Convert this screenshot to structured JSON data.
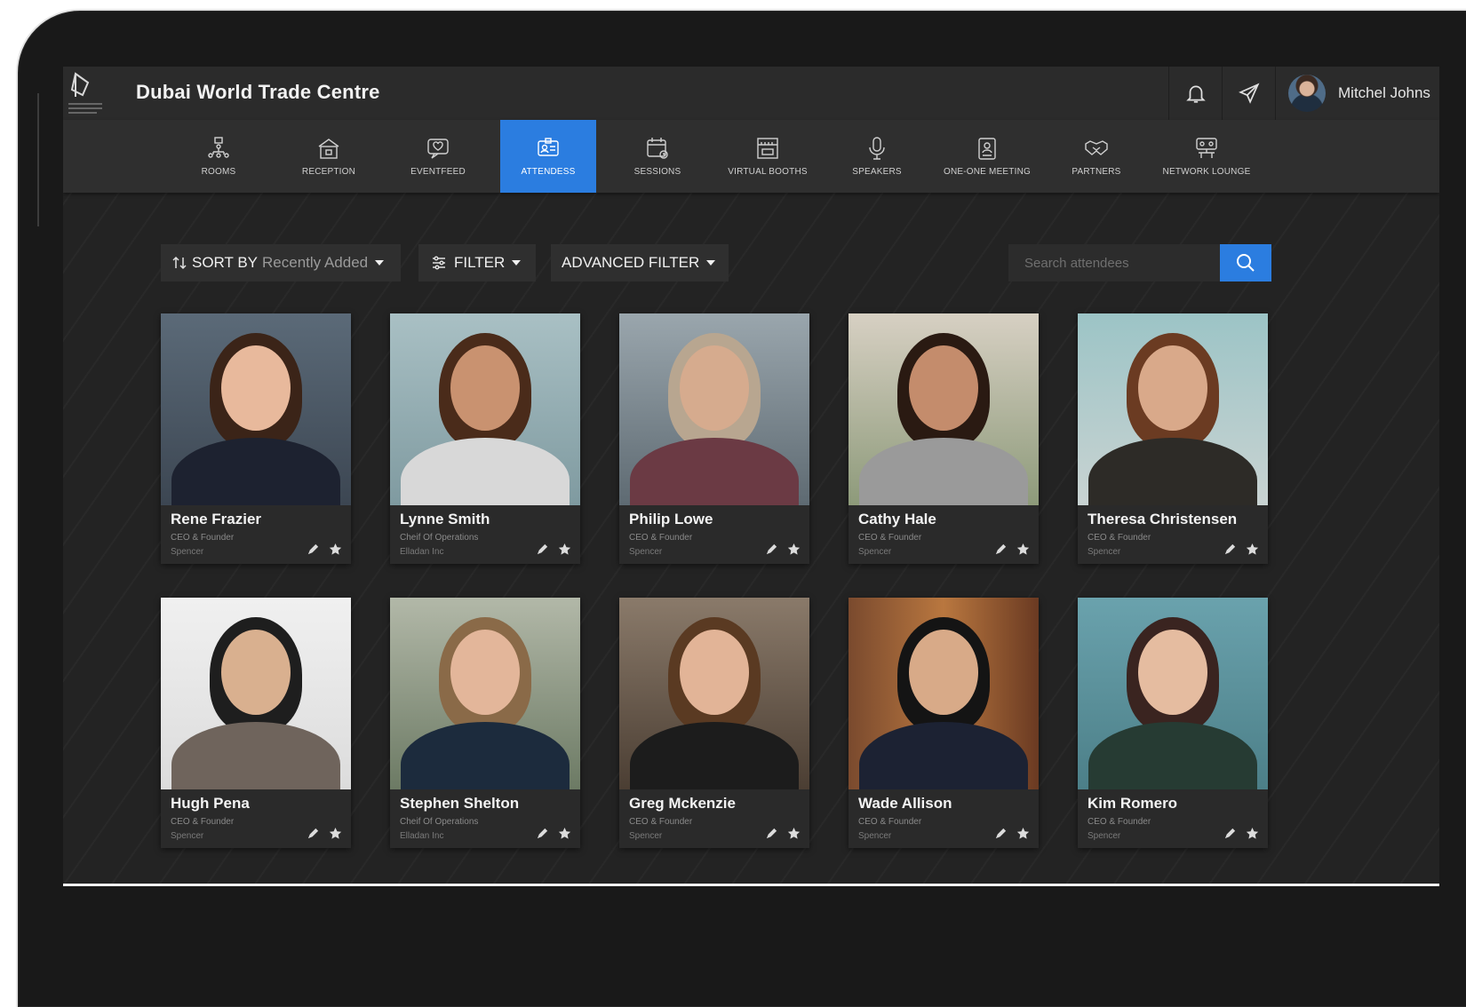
{
  "header": {
    "title": "Dubai World Trade Centre",
    "user_name": "Mitchel Johns",
    "notification_icon": "bell-icon",
    "send_icon": "paper-plane-icon"
  },
  "nav": {
    "active": "ATTENDESS",
    "items": [
      {
        "label": "ROOMS",
        "icon": "rooms-icon"
      },
      {
        "label": "RECEPTION",
        "icon": "reception-icon"
      },
      {
        "label": "EVENTFEED",
        "icon": "eventfeed-icon"
      },
      {
        "label": "ATTENDESS",
        "icon": "attendees-icon"
      },
      {
        "label": "SESSIONS",
        "icon": "sessions-icon"
      },
      {
        "label": "VIRTUAL BOOTHS",
        "icon": "booth-icon"
      },
      {
        "label": "SPEAKERS",
        "icon": "microphone-icon"
      },
      {
        "label": "ONE-ONE MEETING",
        "icon": "meeting-icon"
      },
      {
        "label": "PARTNERS",
        "icon": "handshake-icon"
      },
      {
        "label": "NETWORK LOUNGE",
        "icon": "lounge-icon"
      }
    ]
  },
  "toolbar": {
    "sort_label": "SORT BY",
    "sort_value": "Recently Added",
    "filter_label": "FILTER",
    "advanced_filter_label": "ADVANCED FILTER",
    "search_placeholder": "Search attendees"
  },
  "attendees": [
    {
      "name": "Rene Frazier",
      "role": "CEO & Founder",
      "org": "Spencer"
    },
    {
      "name": "Lynne Smith",
      "role": "Cheif Of Operations",
      "org": "Elladan Inc"
    },
    {
      "name": "Philip Lowe",
      "role": "CEO & Founder",
      "org": "Spencer"
    },
    {
      "name": "Cathy Hale",
      "role": "CEO & Founder",
      "org": "Spencer"
    },
    {
      "name": "Theresa Christensen",
      "role": "CEO & Founder",
      "org": "Spencer"
    },
    {
      "name": "Hugh Pena",
      "role": "CEO & Founder",
      "org": "Spencer"
    },
    {
      "name": "Stephen Shelton",
      "role": "Cheif Of Operations",
      "org": "Elladan Inc"
    },
    {
      "name": "Greg Mckenzie",
      "role": "CEO & Founder",
      "org": "Spencer"
    },
    {
      "name": "Wade Allison",
      "role": "CEO & Founder",
      "org": "Spencer"
    },
    {
      "name": "Kim Romero",
      "role": "CEO & Founder",
      "org": "Spencer"
    }
  ],
  "colors": {
    "accent": "#2b7de0",
    "background": "#232323",
    "panel": "#2f2f2f"
  }
}
